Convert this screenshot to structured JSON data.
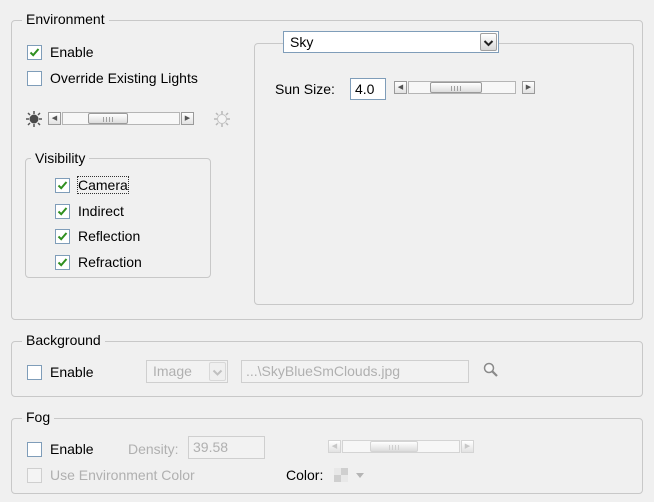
{
  "environment": {
    "title": "Environment",
    "enable_label": "Enable",
    "enable_checked": true,
    "override_label": "Override Existing Lights",
    "override_checked": false,
    "brightness_icon_dark": "sun-dark-icon",
    "brightness_icon_light": "sun-light-icon",
    "visibility": {
      "title": "Visibility",
      "items": [
        {
          "label": "Camera",
          "checked": true
        },
        {
          "label": "Indirect",
          "checked": true
        },
        {
          "label": "Reflection",
          "checked": true
        },
        {
          "label": "Refraction",
          "checked": true
        }
      ]
    },
    "sky": {
      "type_selected": "Sky",
      "sun_size_label": "Sun Size:",
      "sun_size_value": "4.0"
    }
  },
  "background": {
    "title": "Background",
    "enable_label": "Enable",
    "enable_checked": false,
    "source_selected": "Image",
    "file_path": "...\\SkyBlueSmClouds.jpg",
    "browse_icon": "magnifier-icon"
  },
  "fog": {
    "title": "Fog",
    "enable_label": "Enable",
    "enable_checked": false,
    "density_label": "Density:",
    "density_value": "39.58",
    "use_env_color_label": "Use Environment Color",
    "use_env_color_checked": false,
    "color_label": "Color:"
  },
  "colors": {
    "check_green": "#2f8f1f",
    "group_border": "#c8c8c8",
    "field_border": "#7f9db9",
    "disabled_text": "#b0b0b0"
  }
}
